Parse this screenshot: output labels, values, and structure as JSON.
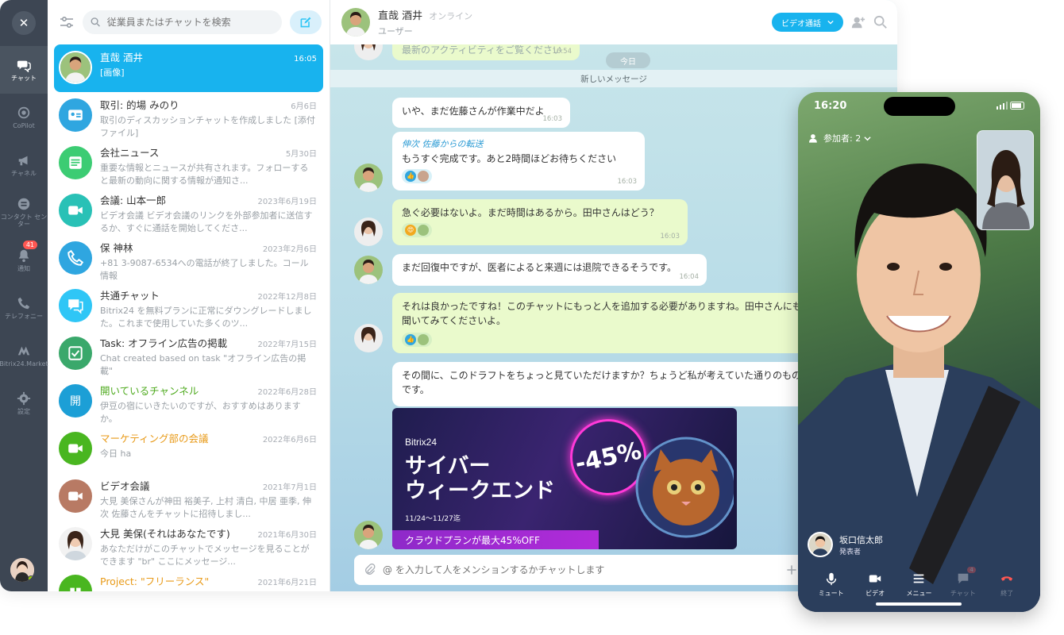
{
  "nav": {
    "close": "✕",
    "items": [
      {
        "label": "チャット",
        "icon": "chat-icon",
        "active": true
      },
      {
        "label": "CoPilot",
        "icon": "copilot-icon"
      },
      {
        "label": "チャネル",
        "icon": "megaphone-icon"
      },
      {
        "label": "コンタクト センター",
        "icon": "contact-center-icon"
      },
      {
        "label": "通知",
        "icon": "bell-icon",
        "badge": "41"
      },
      {
        "label": "テレフォニー",
        "icon": "phone-icon"
      },
      {
        "label": "Bitrix24.Market",
        "icon": "market-icon"
      },
      {
        "label": "設定",
        "icon": "gear-icon"
      }
    ]
  },
  "search": {
    "placeholder": "従業員またはチャットを検索"
  },
  "chats": [
    {
      "title": "直哉 酒井",
      "date": "16:05",
      "snippet": "[画像]",
      "avatar": "photo",
      "active": true
    },
    {
      "title": "取引: 的場 みのり",
      "date": "6月6日",
      "snippet": "取引のディスカッションチャットを作成しました [添付ファイル]",
      "avatar": "deal",
      "color": "#2fa6e0"
    },
    {
      "title": "会社ニュース",
      "date": "5月30日",
      "snippet": "重要な情報とニュースが共有されます。フォローすると最新の動向に関する情報が通知さ...",
      "avatar": "news",
      "color": "#3ccc73"
    },
    {
      "title": "会議: 山本一郎",
      "date": "2023年6月19日",
      "snippet": "ビデオ会議 ビデオ会議のリンクを外部参加者に送信するか、すぐに通話を開始してくださ...",
      "avatar": "video",
      "color": "#29c1b6"
    },
    {
      "title": "保 神林",
      "date": "2023年2月6日",
      "snippet": "+81 3-9087-6534への電話が終了しました。コール情報",
      "avatar": "phone",
      "color": "#2fa6e0"
    },
    {
      "title": "共通チャット",
      "date": "2022年12月8日",
      "snippet": "Bitrix24 を無料プランに正常にダウングレードしました。これまで使用していた多くのツ...",
      "avatar": "general",
      "color": "#2fc6f6"
    },
    {
      "title": "Task: オフライン広告の掲載",
      "date": "2022年7月15日",
      "snippet": "Chat created based on task \"オフライン広告の掲載\"",
      "avatar": "task",
      "color": "#3aa86b"
    },
    {
      "title": "開いているチャンネル",
      "date": "2022年6月28日",
      "snippet": "伊豆の宿にいきたいのですが、おすすめはありますか。",
      "avatar": "open",
      "color": "#1c9fd6",
      "title_style": "green"
    },
    {
      "title": "マーケティング部の会議",
      "date": "2022年6月6日",
      "snippet": "今日 ha",
      "avatar": "video",
      "color": "#49b620",
      "title_style": "orange"
    },
    {
      "title": "ビデオ会議",
      "date": "2021年7月1日",
      "snippet": "大見 美保さんが神田 裕美子, 上村 清白, 中居 亜季, 伸次 佐藤さんをチャットに招待しまし...",
      "avatar": "video",
      "color": "#b87a64"
    },
    {
      "title": "大見 美保(それはあなたです)",
      "date": "2021年6月30日",
      "snippet": "あなただけがこのチャットでメッセージを見ることができます \"br\" ここにメッセージ...",
      "avatar": "photo-f"
    },
    {
      "title": "Project: \"フリーランス\"",
      "date": "2021年6月21日",
      "snippet": "",
      "avatar": "project",
      "color": "#49b620",
      "title_style": "orange"
    }
  ],
  "open_avatar_glyph": "開",
  "header": {
    "name": "直哉 酒井",
    "status": "オンライン",
    "role": "ユーザー",
    "video_button": "ビデオ通話"
  },
  "chat": {
    "day": "今日",
    "new_messages": "新しいメッセージ",
    "partial_top_time": "16:54",
    "partial_top_text": "最新のアクティビティをご覧ください",
    "messages": [
      {
        "text": "いや、まだ佐藤さんが作業中だよ",
        "time": "16:03"
      },
      {
        "forwarded": "伸次 佐藤からの転送",
        "text": "もうすぐ完成です。あと2時間ほどお待ちください",
        "time": "16:03"
      },
      {
        "text": "急ぐ必要はないよ。まだ時間はあるから。田中さんはどう？",
        "time": "16:03"
      },
      {
        "text": "まだ回復中ですが、医者によると来週には退院できるそうです。",
        "time": "16:04"
      },
      {
        "text": "それは良かったですね！このチャットにもっと人を追加する必要がありますね。田中さんにも聞いてみてくださいよ。"
      },
      {
        "text": "その間に、このドラフトをちょっと見ていただけますか？ちょうど私が考えていた通りのものです。"
      }
    ],
    "banner": {
      "brand": "Bitrix24",
      "line1": "サイバー",
      "line2": "ウィークエンド",
      "dates": "11/24〜11/27迄",
      "promo": "クラウドプランが最大45%OFF",
      "discount": "-45%"
    },
    "composer_placeholder": "@ を入力して人をメンションするかチャットします"
  },
  "phone": {
    "time": "16:20",
    "participants": "参加者: 2",
    "speaker_name": "坂口信太郎",
    "speaker_role": "発表者",
    "controls": [
      {
        "label": "ミュート",
        "icon": "mic-icon"
      },
      {
        "label": "ビデオ",
        "icon": "camera-icon"
      },
      {
        "label": "メニュー",
        "icon": "menu-icon"
      },
      {
        "label": "チャット",
        "icon": "chat-bubble-icon",
        "badge": "4"
      },
      {
        "label": "終了",
        "icon": "hangup-icon"
      }
    ]
  }
}
